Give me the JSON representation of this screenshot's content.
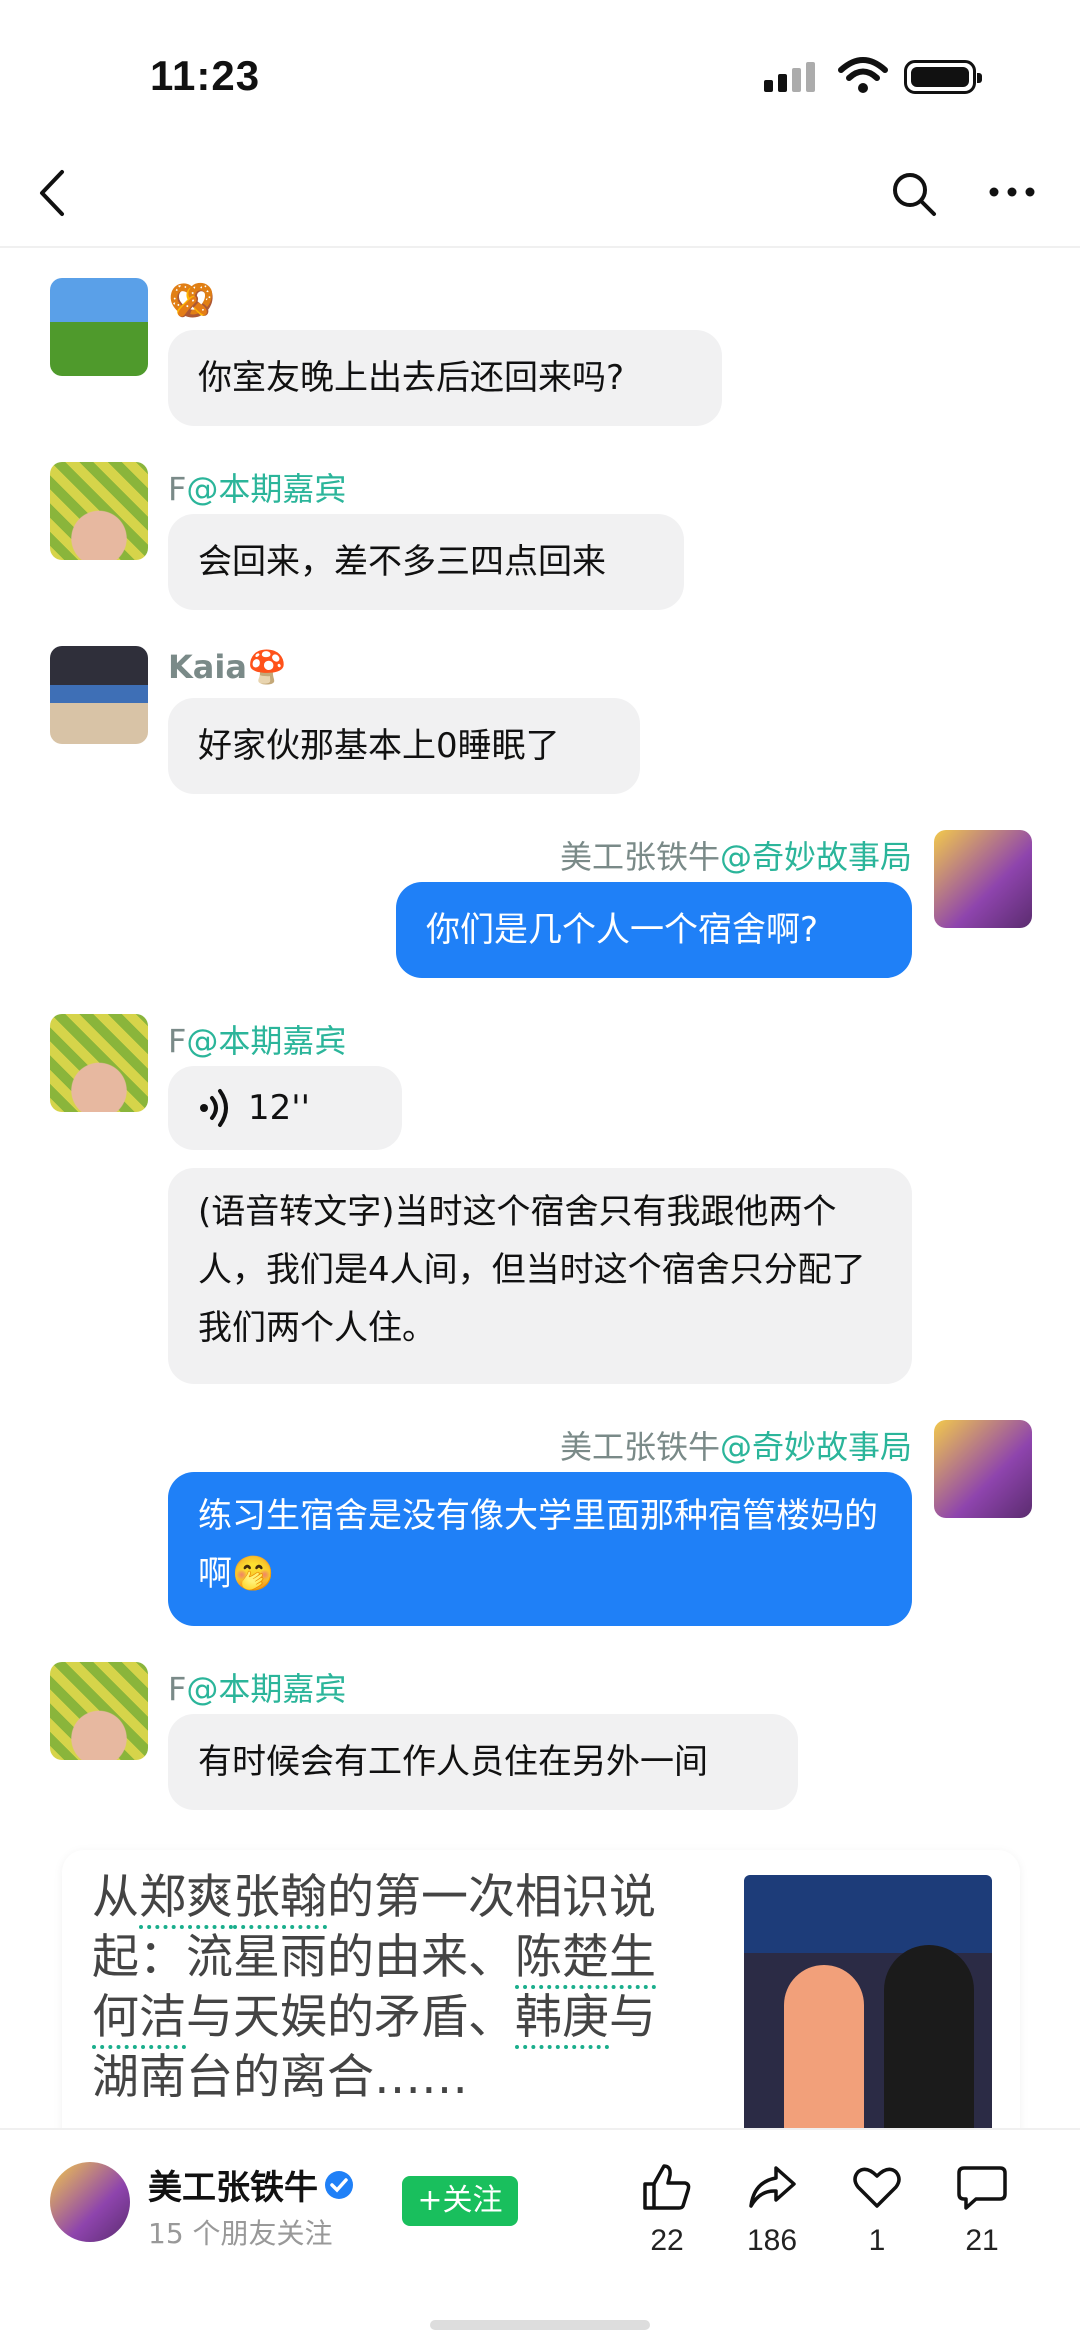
{
  "status_bar": {
    "time": "11:23"
  },
  "messages": [
    {
      "name": "",
      "emoji": "🥨",
      "text": "你室友晚上出去后还回来吗?"
    },
    {
      "name_prefix": "F",
      "name_at": "@本期嘉宾",
      "text": "会回来，差不多三四点回来"
    },
    {
      "name": "Kaia",
      "emoji": "🍄",
      "text": "好家伙那基本上0睡眠了"
    },
    {
      "name_prefix": "美工张铁牛",
      "name_at": "@奇妙故事局",
      "text": "你们是几个人一个宿舍啊?"
    },
    {
      "name_prefix": "F",
      "name_at": "@本期嘉宾",
      "voice": "12''",
      "text": "(语音转文字)当时这个宿舍只有我跟他两个人，我们是4人间，但当时这个宿舍只分配了我们两个人住。"
    },
    {
      "name_prefix": "美工张铁牛",
      "name_at": "@奇妙故事局",
      "text": "练习生宿舍是没有像大学里面那种宿管楼妈的啊🤭"
    },
    {
      "name_prefix": "F",
      "name_at": "@本期嘉宾",
      "text": "有时候会有工作人员住在另外一间"
    }
  ],
  "card": {
    "title_parts": [
      "从",
      "郑爽",
      "张翰",
      "的第一次相识说起：流星雨的由来、",
      "陈楚生",
      "何洁",
      "与天娱的矛盾、",
      "韩庚",
      "与湖南台的离合……"
    ]
  },
  "bottom": {
    "author": "美工张铁牛",
    "followers": "15 个朋友关注",
    "follow_label": "+关注",
    "likes": "22",
    "shares": "186",
    "favs": "1",
    "comments": "21"
  },
  "colors": {
    "accent_green": "#2bb59a",
    "my_bubble": "#1f80f7",
    "follow_button": "#19bf5d"
  }
}
